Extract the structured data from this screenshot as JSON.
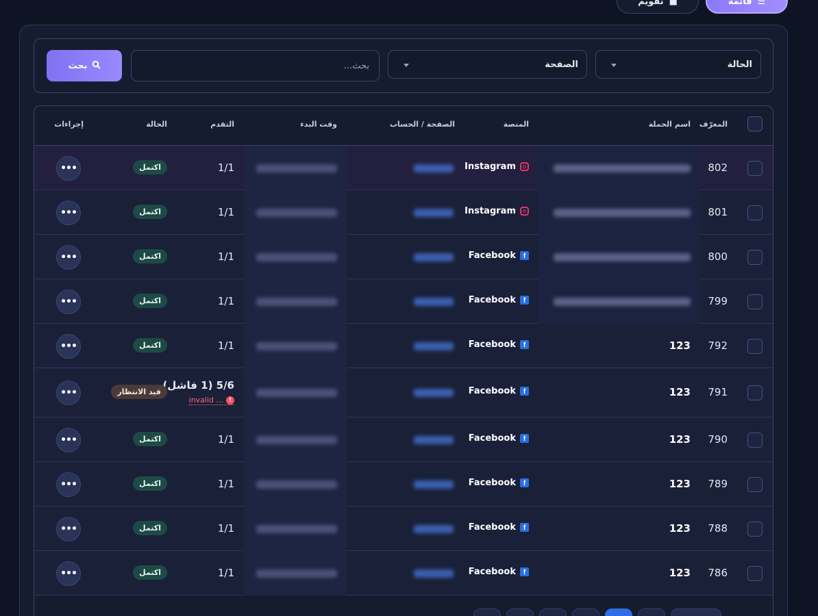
{
  "view_toggle": {
    "list_label": "قائمة",
    "calendar_label": "تقويم"
  },
  "filters": {
    "status_label": "الحالة",
    "page_label": "الصفحة",
    "search_placeholder": "بحث...",
    "search_button": "بحث"
  },
  "table": {
    "headers": {
      "id": "المعرّف",
      "name": "اسم الحملة",
      "platform": "المنصة",
      "account": "الصفحة / الحساب",
      "start": "وقت البدء",
      "progress": "التقدم",
      "status": "الحالة",
      "actions": "إجراءات"
    },
    "rows": [
      {
        "id": "802",
        "name": "",
        "platform": "Instagram",
        "progress": "1/1",
        "status": "اكتمل",
        "status_type": "done"
      },
      {
        "id": "801",
        "name": "",
        "platform": "Instagram",
        "progress": "1/1",
        "status": "اكتمل",
        "status_type": "done"
      },
      {
        "id": "800",
        "name": "",
        "platform": "Facebook",
        "progress": "1/1",
        "status": "اكتمل",
        "status_type": "done"
      },
      {
        "id": "799",
        "name": "",
        "platform": "Facebook",
        "progress": "1/1",
        "status": "اكتمل",
        "status_type": "done"
      },
      {
        "id": "792",
        "name": "123",
        "platform": "Facebook",
        "progress": "1/1",
        "status": "اكتمل",
        "status_type": "done"
      },
      {
        "id": "791",
        "name": "123",
        "platform": "Facebook",
        "progress": "5/6 (1 فاشل)",
        "error": "invalid ...",
        "status": "قيد الانتظار",
        "status_type": "pending"
      },
      {
        "id": "790",
        "name": "123",
        "platform": "Facebook",
        "progress": "1/1",
        "status": "اكتمل",
        "status_type": "done"
      },
      {
        "id": "789",
        "name": "123",
        "platform": "Facebook",
        "progress": "1/1",
        "status": "اكتمل",
        "status_type": "done"
      },
      {
        "id": "788",
        "name": "123",
        "platform": "Facebook",
        "progress": "1/1",
        "status": "اكتمل",
        "status_type": "done"
      },
      {
        "id": "786",
        "name": "123",
        "platform": "Facebook",
        "progress": "1/1",
        "status": "اكتمل",
        "status_type": "done"
      }
    ]
  },
  "colors": {
    "accent": "#8c7af6",
    "done_badge": "#1e4a46",
    "pending_badge": "#4a3a38",
    "facebook": "#2a6fdf",
    "instagram": "#e0366a"
  }
}
